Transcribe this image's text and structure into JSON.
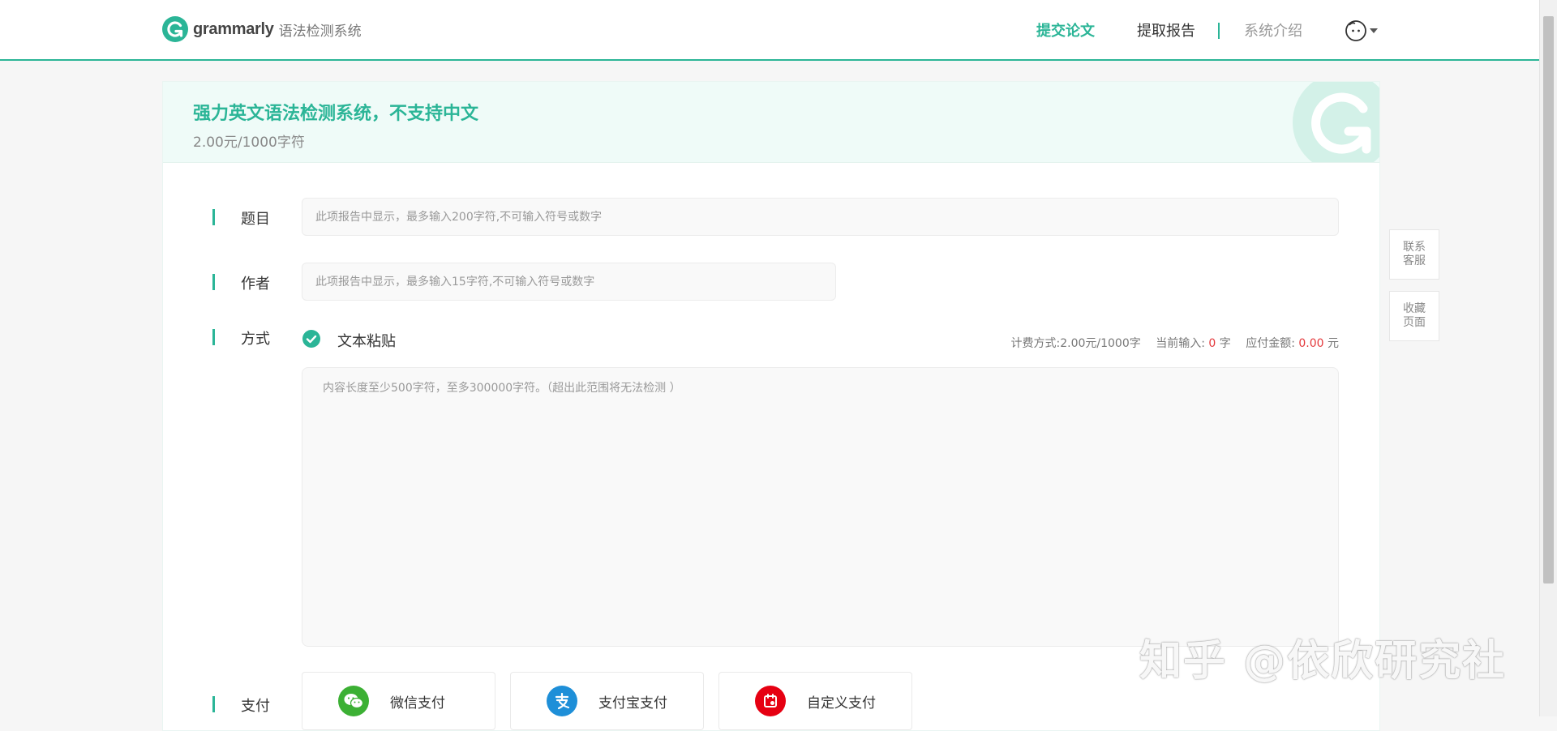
{
  "header": {
    "brand_name": "grammarly",
    "brand_sub": "语法检测系统",
    "nav": {
      "submit": "提交论文",
      "report": "提取报告",
      "intro": "系统介绍"
    }
  },
  "banner": {
    "title": "强力英文语法检测系统，不支持中文",
    "price": "2.00元/1000字符"
  },
  "form": {
    "title_label": "题目",
    "title_placeholder": "此项报告中显示，最多输入200字符,不可输入符号或数字",
    "author_label": "作者",
    "author_placeholder": "此项报告中显示，最多输入15字符,不可输入符号或数字",
    "method_label": "方式",
    "method_option": "文本粘贴",
    "billing": {
      "method_text": "计费方式:2.00元/1000字",
      "current_label": "当前输入:",
      "current_value": "0",
      "current_unit": "字",
      "amount_label": "应付金额:",
      "amount_value": "0.00",
      "amount_unit": "元"
    },
    "content_placeholder": "内容长度至少500字符，至多300000字符。（超出此范围将无法检测 ）",
    "pay_label": "支付",
    "pay_options": [
      {
        "label": "微信支付",
        "icon": "wechat-pay-icon",
        "color": "#3cb034"
      },
      {
        "label": "支付宝支付",
        "icon": "alipay-icon",
        "color": "#1e8fd8"
      },
      {
        "label": "自定义支付",
        "icon": "custom-pay-icon",
        "color": "#e60012"
      }
    ]
  },
  "side": {
    "service": "联系客服",
    "bookmark": "收藏页面"
  },
  "watermark": "知乎 @依欣研究社",
  "colors": {
    "accent": "#2bb597",
    "danger": "#e4393c"
  }
}
